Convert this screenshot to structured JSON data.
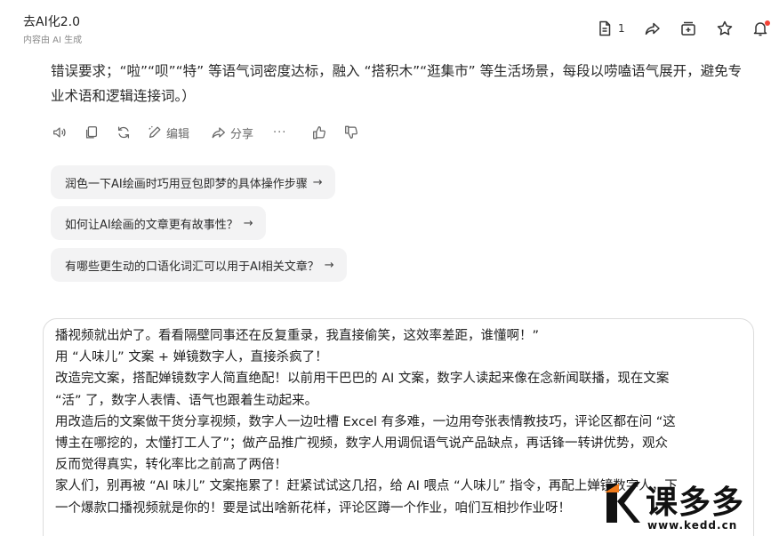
{
  "header": {
    "title": "去AI化2.0",
    "subtitle": "内容由 AI 生成",
    "doc_count": "1"
  },
  "message": {
    "tail_text": "错误要求；“啦”“呗”“特” 等语气词密度达标，融入 “搭积木”“逛集市” 等生活场景，每段以唠嗑语气展开，避免专业术语和逻辑连接词。）"
  },
  "actions": {
    "edit_label": "编辑",
    "share_label": "分享",
    "more_label": "···"
  },
  "suggestions": [
    {
      "text": "润色一下AI绘画时巧用豆包即梦的具体操作步骤"
    },
    {
      "text": "如何让AI绘画的文章更有故事性？"
    },
    {
      "text": "有哪些更生动的口语化词汇可以用于AI相关文章？"
    }
  ],
  "input": {
    "lines": [
      "播视频就出炉了。看看隔壁同事还在反复重录，我直接偷笑，这效率差距，谁懂啊！”",
      "用 “人味儿” 文案 + 婵镜数字人，直接杀疯了！",
      "改造完文案，搭配婵镜数字人简直绝配！以前用干巴巴的 AI 文案，数字人读起来像在念新闻联播，现在文案",
      "“活” 了，数字人表情、语气也跟着生动起来。",
      "用改造后的文案做干货分享视频，数字人一边吐槽 Excel 有多难，一边用夸张表情教技巧，评论区都在问 “这",
      "博主在哪挖的，太懂打工人了”；做产品推广视频，数字人用调侃语气说产品缺点，再话锋一转讲优势，观众",
      "反而觉得真实，转化率比之前高了两倍！",
      "家人们，别再被 “AI 味儿” 文案拖累了！赶紧试试这几招，给 AI 喂点 “人味儿” 指令，再配上婵镜数字人，下",
      "一个爆款口播视频就是你的！要是试出啥新花样，评论区蹲一个作业，咱们互相抄作业呀！"
    ]
  },
  "watermark": {
    "brand": "课多多",
    "url": "www.kedd.cn"
  },
  "colors": {
    "suggestion_bg": "#f3f3f4",
    "notification_dot": "#f44336",
    "watermark_orange": "#f07a1a"
  },
  "icons": [
    "document-icon",
    "share-icon",
    "save-icon",
    "star-icon",
    "bell-icon",
    "speaker-icon",
    "copy-icon",
    "regenerate-icon",
    "edit-icon",
    "share-icon",
    "more-icon",
    "thumbs-up-icon",
    "thumbs-down-icon",
    "arrow-right-icon"
  ]
}
